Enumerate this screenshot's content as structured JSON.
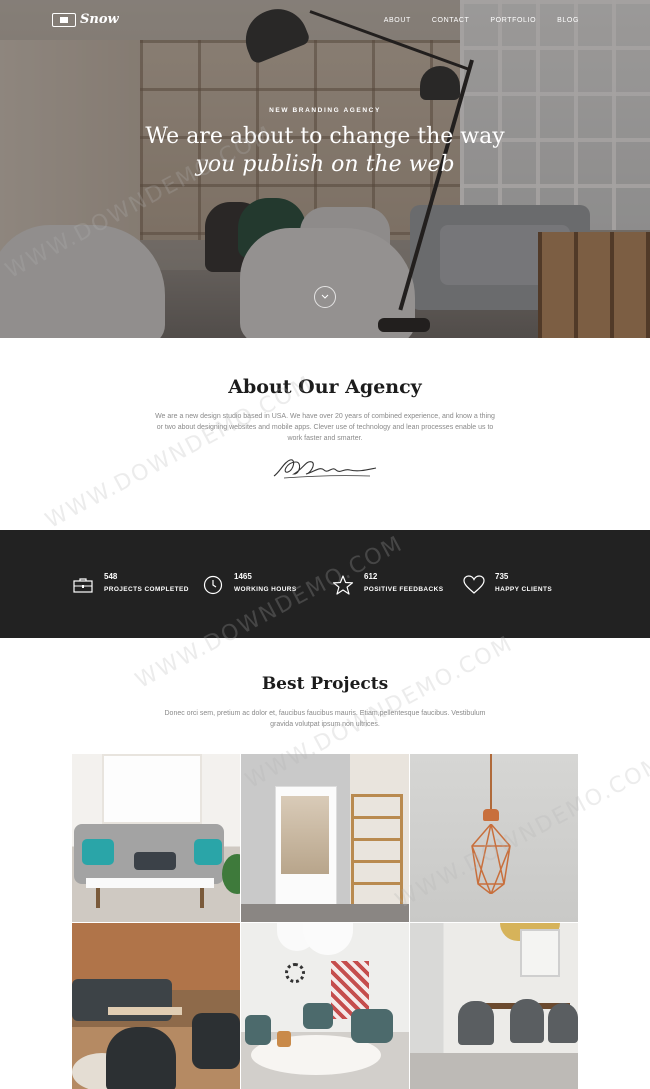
{
  "nav": {
    "logo_text": "Snow",
    "menu": [
      "ABOUT",
      "CONTACT",
      "PORTFOLIO",
      "BLOG"
    ]
  },
  "hero": {
    "subtitle": "NEW BRANDING AGENCY",
    "title_line1": "We are about to change the way",
    "title_line2": "you publish on the web"
  },
  "about": {
    "title": "About Our Agency",
    "text": "We are a new design studio based in USA. We have over 20 years of combined experience, and know a thing or two about designing websites and mobile apps. Clever use of technology and lean processes enable us to work faster and smarter."
  },
  "stats": [
    {
      "number": "548",
      "label": "PROJECTS COMPLETED",
      "icon": "briefcase-icon"
    },
    {
      "number": "1465",
      "label": "WORKING HOURS",
      "icon": "clock-icon"
    },
    {
      "number": "612",
      "label": "POSITIVE FEEDBACKS",
      "icon": "star-icon"
    },
    {
      "number": "735",
      "label": "HAPPY CLIENTS",
      "icon": "heart-icon"
    }
  ],
  "projects": {
    "title": "Best Projects",
    "text": "Donec orci sem, pretium ac dolor et, faucibus faucibus mauris. Etiam,pellentesque faucibus. Vestibulum gravida volutpat ipsum non ultrices."
  },
  "watermark": "WWW.DOWNDEMO.COM",
  "colors": {
    "stats_bg": "#222222",
    "heading": "#1c1c1c",
    "body_text": "#8a8a8a"
  }
}
